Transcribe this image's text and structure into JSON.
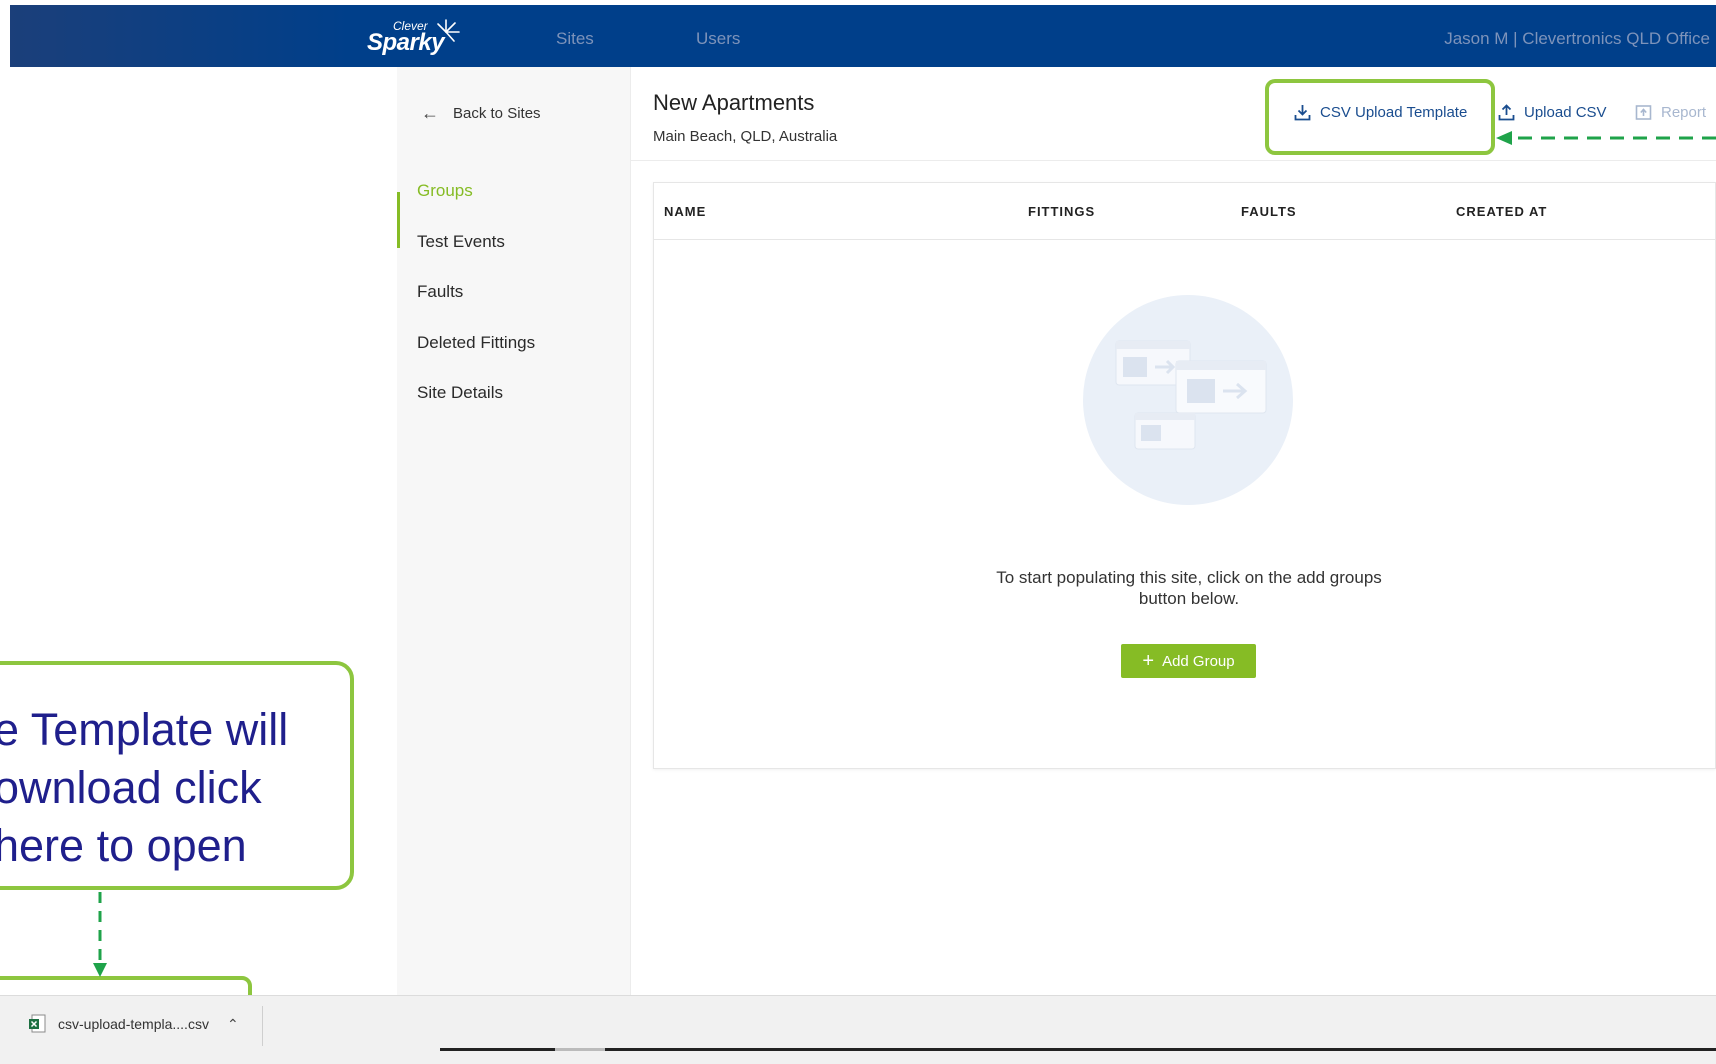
{
  "app": {
    "logo_small": "Clever",
    "logo_main": "Sparky"
  },
  "nav": {
    "sites": "Sites",
    "users": "Users",
    "user_menu": "Jason M | Clevertronics QLD Office"
  },
  "sidebar": {
    "back": "Back to Sites",
    "items": [
      {
        "label": "Groups",
        "active": true
      },
      {
        "label": "Test Events"
      },
      {
        "label": "Faults"
      },
      {
        "label": "Deleted Fittings"
      },
      {
        "label": "Site Details"
      }
    ]
  },
  "site": {
    "title": "New Apartments",
    "address": "Main Beach, QLD, Australia"
  },
  "actions": {
    "csv_template": "CSV Upload Template",
    "upload_csv": "Upload CSV",
    "report": "Report"
  },
  "table": {
    "columns": [
      "NAME",
      "FITTINGS",
      "FAULTS",
      "CREATED AT"
    ],
    "rows": [],
    "empty_message": "To start populating this site, click on the add groups button below.",
    "add_button": "Add Group"
  },
  "callout": {
    "line1": "e Template will",
    "line2": "ownload click",
    "line3": "here to open"
  },
  "downloads": {
    "file_name": "csv-upload-templa....csv"
  },
  "colors": {
    "topbar": "#003f8a",
    "accent_green": "#86bc25",
    "link_blue": "#1a4d8f",
    "callout_text": "#1f1f8c",
    "annotation_green": "#8dc63f"
  },
  "icons": {
    "back": "arrow-left-icon",
    "csv_template": "download-tray-icon",
    "upload_csv": "upload-tray-icon",
    "report": "report-icon",
    "add": "plus-icon",
    "download_file": "excel-file-icon",
    "download_menu": "chevron-up-icon"
  }
}
